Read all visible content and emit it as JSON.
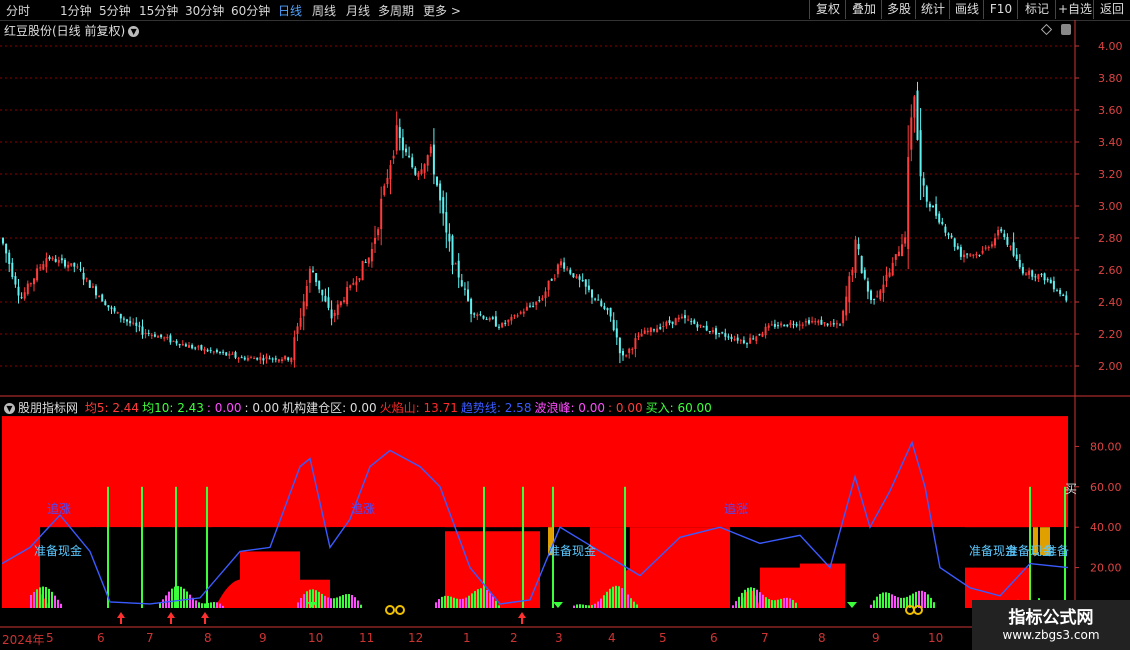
{
  "toolbar": {
    "periods": [
      "分时",
      "1分钟",
      "5分钟",
      "15分钟",
      "30分钟",
      "60分钟",
      "日线",
      "周线",
      "月线",
      "多周期",
      "更多 >"
    ],
    "active_period": "日线",
    "right_buttons": [
      "复权",
      "叠加",
      "多股",
      "统计",
      "画线",
      "F10",
      "标记",
      "+自选",
      "返回"
    ]
  },
  "main_chart": {
    "title": "红豆股份(日线 前复权)",
    "yticks": [
      "4.00",
      "3.80",
      "3.60",
      "3.40",
      "3.20",
      "3.00",
      "2.80",
      "2.60",
      "2.40",
      "2.20",
      "2.00"
    ]
  },
  "indicator": {
    "name": "股朋指标网",
    "values": [
      {
        "label": "均5:",
        "value": "2.44",
        "color": "#ff3b3b"
      },
      {
        "label": "均10:",
        "value": "2.43",
        "color": "#3cff3c"
      },
      {
        "label": ":",
        "value": "0.00",
        "color": "#ff4cff"
      },
      {
        "label": ":",
        "value": "0.00",
        "color": "#dddddd"
      },
      {
        "label": "机构建仓区:",
        "value": "0.00",
        "color": "#dddddd"
      },
      {
        "label": "火焰山:",
        "value": "13.71",
        "color": "#ff2a2a"
      },
      {
        "label": "趋势线:",
        "value": "2.58",
        "color": "#3a5bff"
      },
      {
        "label": "波浪峰:",
        "value": "0.00",
        "color": "#ff4cff"
      },
      {
        "label": ":",
        "value": "0.00",
        "color": "#ff3b3b"
      },
      {
        "label": "买入:",
        "value": "60.00",
        "color": "#3cff3c"
      }
    ],
    "yticks": [
      "80.00",
      "60.00",
      "40.00",
      "20.00"
    ],
    "labels": {
      "chase1": "追涨",
      "chase2": "追涨",
      "chase3": "追涨",
      "cash1": "准备现金",
      "cash2": "准备现金",
      "cash3": "准备现金",
      "cash4": "准备现金",
      "cash5": "准备",
      "buy": "买"
    }
  },
  "xaxis": {
    "labels": [
      "2024年",
      "5",
      "6",
      "7",
      "8",
      "9",
      "10",
      "11",
      "12",
      "1",
      "2",
      "3",
      "4",
      "5",
      "6",
      "7",
      "8",
      "9",
      "10"
    ]
  },
  "watermark": {
    "line1": "指标公式网",
    "line2": "www.zbgs3.com"
  },
  "colors": {
    "up": "#ff3b3b",
    "down": "#5ff0f0",
    "grid": "#8b0000",
    "axis": "#c33",
    "trend": "#3a5bff",
    "fire": "#ff0000",
    "buy": "#3cff3c"
  }
}
